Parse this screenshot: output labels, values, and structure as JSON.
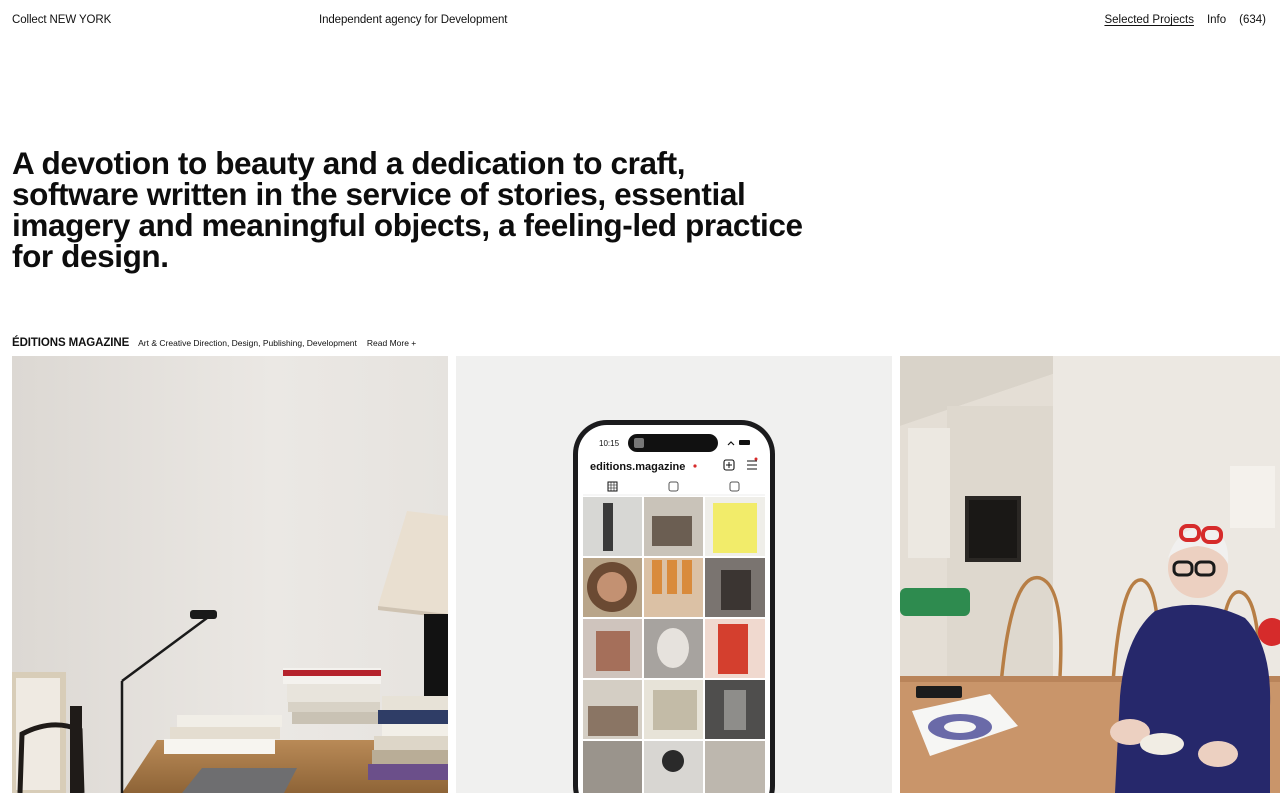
{
  "header": {
    "brand": "Collect NEW YORK",
    "tagline": "Independent agency for Development",
    "nav": {
      "selected_projects": "Selected Projects",
      "info": "Info",
      "count": "(634)"
    }
  },
  "hero": {
    "statement": "A devotion to beauty and a dedication to craft, software written in the service of stories, essential imagery and meaningful objects, a feeling-led practice for design."
  },
  "project": {
    "title": "ÉDITIONS MAGAZINE",
    "services": "Art & Creative Direction, Design, Publishing, Development",
    "read_more": "Read More +"
  },
  "phone": {
    "time": "10:15",
    "username": "editions.magazine"
  },
  "colors": {
    "text": "#111111",
    "background": "#ffffff",
    "panel_gray": "#f0f0ef",
    "accent_red": "#d62b2b"
  }
}
